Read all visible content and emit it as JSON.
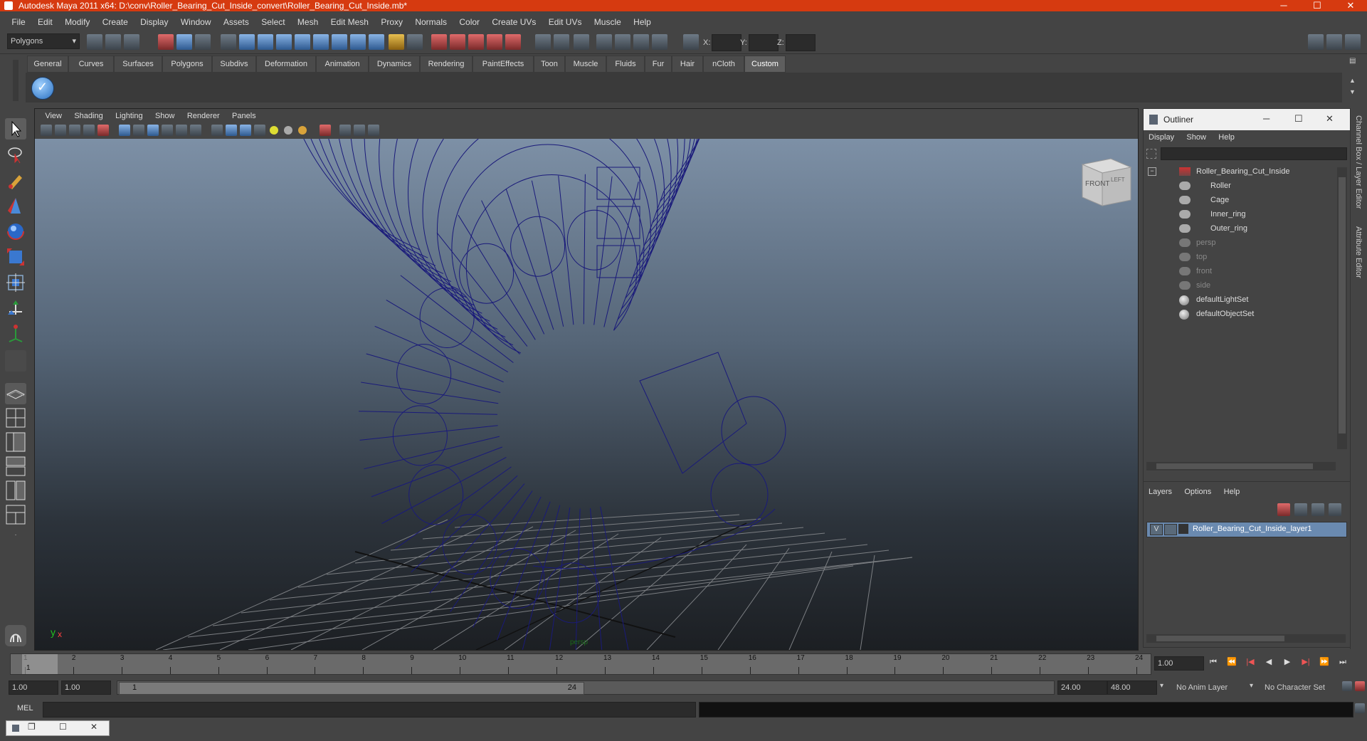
{
  "window": {
    "title": "Autodesk Maya 2011 x64: D:\\conv\\Roller_Bearing_Cut_Inside_convert\\Roller_Bearing_Cut_Inside.mb*",
    "minimize": "─",
    "maximize": "☐",
    "close": "✕"
  },
  "menubar": [
    "File",
    "Edit",
    "Modify",
    "Create",
    "Display",
    "Window",
    "Assets",
    "Select",
    "Mesh",
    "Edit Mesh",
    "Proxy",
    "Normals",
    "Color",
    "Create UVs",
    "Edit UVs",
    "Muscle",
    "Help"
  ],
  "status": {
    "mode": "Polygons",
    "x_label": "X:",
    "y_label": "Y:",
    "z_label": "Z:"
  },
  "shelf_tabs": [
    "General",
    "Curves",
    "Surfaces",
    "Polygons",
    "Subdivs",
    "Deformation",
    "Animation",
    "Dynamics",
    "Rendering",
    "PaintEffects",
    "Toon",
    "Muscle",
    "Fluids",
    "Fur",
    "Hair",
    "nCloth",
    "Custom"
  ],
  "shelf_active": "Custom",
  "viewport": {
    "menus": [
      "View",
      "Shading",
      "Lighting",
      "Show",
      "Renderer",
      "Panels"
    ],
    "viewcube_front": "FRONT",
    "viewcube_side": "LEFT",
    "camera_label": "persp",
    "axis_y": "y",
    "axis_x": "x",
    "wire_color": "#1a1a7a"
  },
  "outliner": {
    "title": "Outliner",
    "menus": [
      "Display",
      "Show",
      "Help"
    ],
    "items": [
      {
        "label": "Roller_Bearing_Cut_Inside",
        "dim": false,
        "indent": 0
      },
      {
        "label": "Roller",
        "dim": false,
        "indent": 1
      },
      {
        "label": "Cage",
        "dim": false,
        "indent": 1
      },
      {
        "label": "Inner_ring",
        "dim": false,
        "indent": 1
      },
      {
        "label": "Outer_ring",
        "dim": false,
        "indent": 1
      },
      {
        "label": "persp",
        "dim": true,
        "indent": 0
      },
      {
        "label": "top",
        "dim": true,
        "indent": 0
      },
      {
        "label": "front",
        "dim": true,
        "indent": 0
      },
      {
        "label": "side",
        "dim": true,
        "indent": 0
      },
      {
        "label": "defaultLightSet",
        "dim": false,
        "indent": 0
      },
      {
        "label": "defaultObjectSet",
        "dim": false,
        "indent": 0
      }
    ]
  },
  "layers": {
    "menus": [
      "Layers",
      "Options",
      "Help"
    ],
    "layer_v": "V",
    "layer_name": "Roller_Bearing_Cut_Inside_layer1"
  },
  "right_tabs": [
    "Channel Box / Layer Editor",
    "Attribute Editor"
  ],
  "timeline": {
    "ticks": [
      "1",
      "2",
      "3",
      "4",
      "5",
      "6",
      "7",
      "8",
      "9",
      "10",
      "11",
      "12",
      "13",
      "14",
      "15",
      "16",
      "17",
      "18",
      "19",
      "20",
      "21",
      "22",
      "23",
      "24"
    ],
    "current_marker": "1",
    "current_frame": "1.00"
  },
  "range": {
    "start": "1.00",
    "playback_start": "1.00",
    "slider_start": "1",
    "slider_end": "24",
    "playback_end": "24.00",
    "end": "48.00",
    "anim_layer": "No Anim Layer",
    "character_set": "No Character Set"
  },
  "cmdline": {
    "label": "MEL"
  }
}
